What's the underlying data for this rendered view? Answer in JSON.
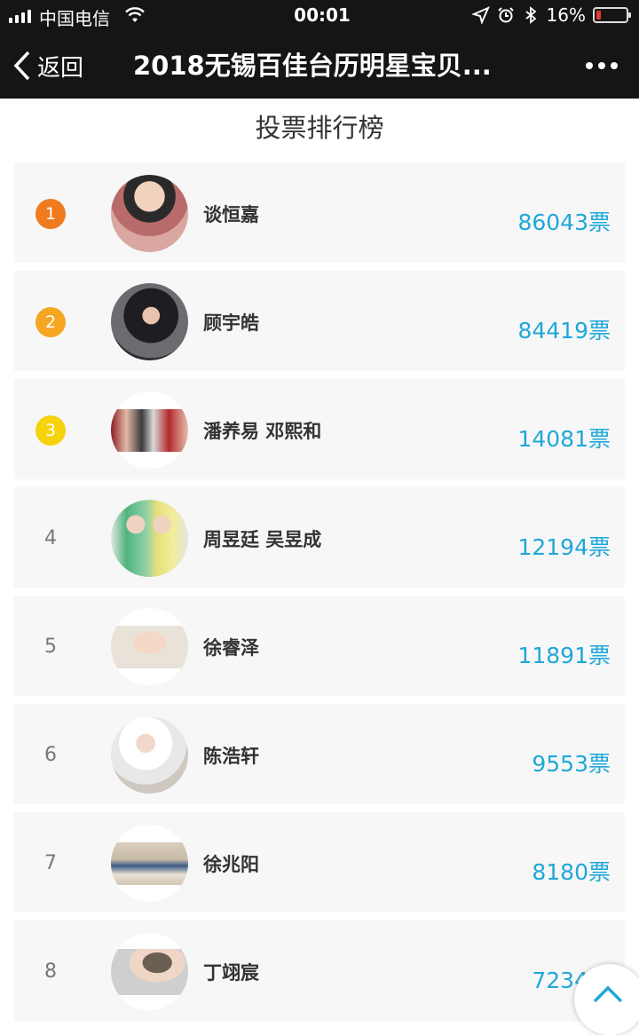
{
  "status_bar": {
    "carrier": "中国电信",
    "time": "00:01",
    "battery": "16%",
    "battery_level": 0.16
  },
  "nav": {
    "back_label": "返回",
    "title": "2018无锡百佳台历明星宝贝..."
  },
  "page_title": "投票排行榜",
  "colors": {
    "vote": "#1fa8d8",
    "rank1": "#f07a1f",
    "rank2": "#f5a623",
    "rank3": "#f5d20a",
    "navbar": "#151515"
  },
  "ranking": [
    {
      "rank": "1",
      "name": "谈恒嘉",
      "votes": "86043",
      "unit": "票"
    },
    {
      "rank": "2",
      "name": "顾宇皓",
      "votes": "84419",
      "unit": "票"
    },
    {
      "rank": "3",
      "name": "潘养易 邓熙和",
      "votes": "14081",
      "unit": "票"
    },
    {
      "rank": "4",
      "name": "周昱廷 吴昱成",
      "votes": "12194",
      "unit": "票"
    },
    {
      "rank": "5",
      "name": "徐睿泽",
      "votes": "11891",
      "unit": "票"
    },
    {
      "rank": "6",
      "name": "陈浩轩",
      "votes": "9553",
      "unit": "票"
    },
    {
      "rank": "7",
      "name": "徐兆阳",
      "votes": "8180",
      "unit": "票"
    },
    {
      "rank": "8",
      "name": "丁翊宸",
      "votes": "7234",
      "unit": "票"
    }
  ]
}
